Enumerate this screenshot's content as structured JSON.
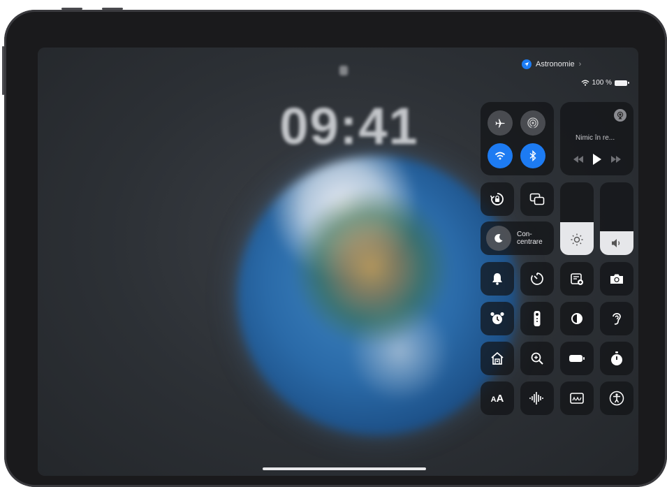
{
  "status_bar": {
    "focus_label": "Astronomie",
    "wifi_icon": "wifi-icon",
    "battery_text": "100 %"
  },
  "lock_screen": {
    "time": "09:41"
  },
  "control_center": {
    "connectivity": {
      "airplane": "airplane-icon",
      "airdrop": "airdrop-icon",
      "wifi": "wifi-icon",
      "bluetooth": "bluetooth-icon"
    },
    "now_playing": {
      "title": "Nimic în re...",
      "airplay": "airplay-icon"
    },
    "focus": {
      "label_line1": "Con-",
      "label_line2": "centrare"
    },
    "brightness_level": 0.45,
    "volume_level": 0.33,
    "tiles": [
      "bell-icon",
      "timer-icon",
      "quick-note-icon",
      "camera-icon",
      "alarm-icon",
      "remote-icon",
      "dark-mode-icon",
      "hearing-icon",
      "home-icon",
      "magnifier-icon",
      "low-power-icon",
      "stopwatch-icon",
      "text-size-icon",
      "sound-recognition-icon",
      "live-captions-icon",
      "accessibility-icon"
    ]
  },
  "colors": {
    "accent": "#1d7bf2",
    "tile_bg": "#121316",
    "fill": "#e6e7ea"
  }
}
